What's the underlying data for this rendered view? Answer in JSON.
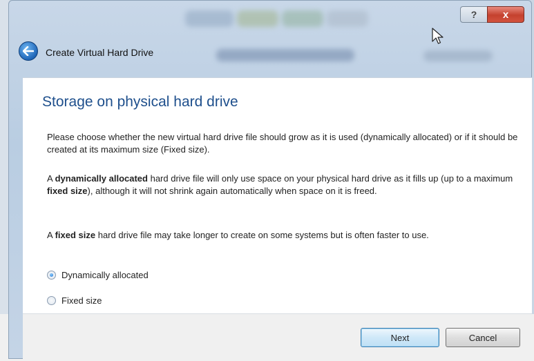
{
  "window": {
    "title": "Create Virtual Hard Drive",
    "help_label": "?",
    "close_label": "x"
  },
  "page": {
    "heading": "Storage on physical hard drive",
    "para1": "Please choose whether the new virtual hard drive file should grow as it is used (dynamically allocated) or if it should be created at its maximum size (Fixed size).",
    "para2": {
      "a": "A ",
      "b": "dynamically allocated",
      "c": " hard drive file will only use space on your physical hard drive as it fills up (up to a maximum ",
      "d": "fixed size",
      "e": "), although it will not shrink again automatically when space on it is freed."
    },
    "para3": {
      "a": "A ",
      "b": "fixed size",
      "c": " hard drive file may take longer to create on some systems but is often faster to use."
    },
    "options": [
      {
        "label": "Dynamically allocated",
        "checked": true
      },
      {
        "label": "Fixed size",
        "checked": false
      }
    ]
  },
  "footer": {
    "next_label": "Next",
    "cancel_label": "Cancel"
  },
  "colors": {
    "heading": "#1e4f8c",
    "accent": "#1f66b8",
    "close": "#c4412e"
  },
  "icons": {
    "back": "back-arrow-icon",
    "cursor": "mouse-pointer-icon"
  }
}
